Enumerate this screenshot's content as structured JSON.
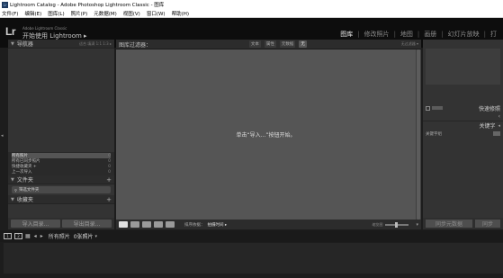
{
  "window": {
    "app_icon": "Lr",
    "title": "Lightroom Catalog - Adobe Photoshop Lightroom Classic - 图库"
  },
  "menubar": [
    "文件(F)",
    "编辑(E)",
    "图库(L)",
    "照片(P)",
    "元数据(M)",
    "视图(V)",
    "窗口(W)",
    "帮助(H)"
  ],
  "identity": {
    "logo": "Lr",
    "small": "Adobe Lightroom Classic",
    "big": "开始使用 Lightroom ▸"
  },
  "modules": [
    "图库",
    "修改照片",
    "地图",
    "画册",
    "幻灯片放映",
    "打"
  ],
  "left_panel": {
    "navigator": {
      "label": "导航器",
      "options": "适合  填满  1:1  1:3 ▸"
    },
    "catalog_rows": [
      {
        "label": "所有照片",
        "count": "0"
      },
      {
        "label": "所有已同步照片",
        "count": "0"
      },
      {
        "label": "快捷收藏夹 +",
        "count": "0"
      },
      {
        "label": "上一次导入",
        "count": "0"
      }
    ],
    "folders": {
      "label": "文件夹",
      "plus": "+",
      "filter_placeholder": "筛选文件夹"
    },
    "collections": {
      "label": "收藏夹",
      "plus": "+"
    },
    "buttons": {
      "import": "导入目录...",
      "export": "导出目录..."
    }
  },
  "filterbar": {
    "label": "图库过滤器：",
    "tabs": [
      "文本",
      "属性",
      "元数据",
      "无"
    ],
    "right": "无过滤器 ▾"
  },
  "grid": {
    "message": "单击“导入...”按钮开始。"
  },
  "toolbar": {
    "sort_label": "排序依据：",
    "sort_value": "拍摄时间 ▸",
    "thumb_label": "缩览图",
    "dropdown": "▾"
  },
  "right_panel": {
    "histo_label": "快速修照",
    "sub_arrow": "‹",
    "section_label": "关键字",
    "keyword_row": "关键字组",
    "buttons": {
      "sync": "同步元数据",
      "sync2": "同步"
    }
  },
  "filmstrip": {
    "source": "所有照片",
    "count": "0张照片",
    "dd": "▾"
  }
}
